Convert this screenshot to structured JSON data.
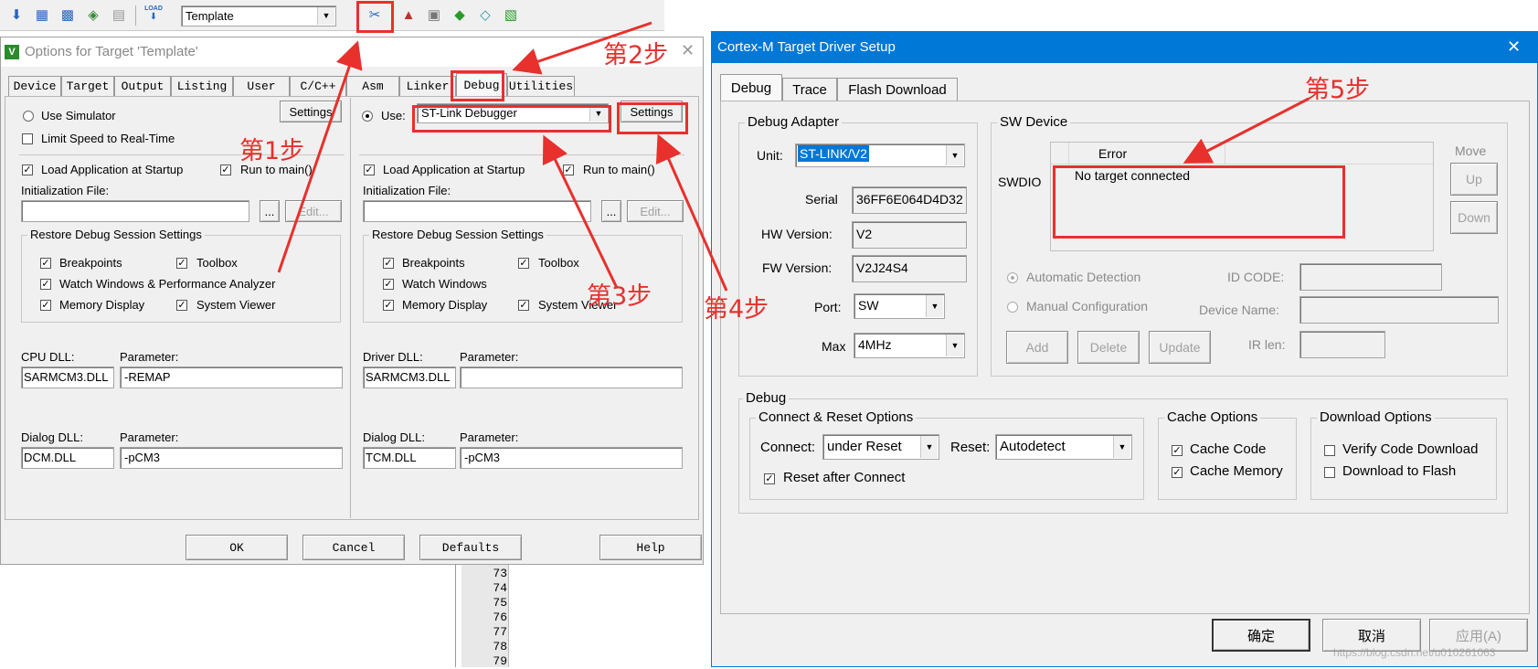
{
  "toolbar": {
    "project": "Template"
  },
  "options": {
    "title": "Options for Target 'Template'",
    "tabs": [
      "Device",
      "Target",
      "Output",
      "Listing",
      "User",
      "C/C++",
      "Asm",
      "Linker",
      "Debug",
      "Utilities"
    ],
    "left": {
      "use_simulator": "Use Simulator",
      "limit_speed": "Limit Speed to Real-Time",
      "settings": "Settings",
      "load_app": "Load Application at Startup",
      "run_to_main": "Run to main()",
      "init_file": "Initialization File:",
      "browse": "...",
      "edit": "Edit...",
      "restore_title": "Restore Debug Session Settings",
      "breakpoints": "Breakpoints",
      "toolbox": "Toolbox",
      "watch": "Watch Windows & Performance Analyzer",
      "memory": "Memory Display",
      "system_viewer": "System Viewer",
      "cpu_dll_label": "CPU DLL:",
      "cpu_param_label": "Parameter:",
      "cpu_dll": "SARMCM3.DLL",
      "cpu_param": "-REMAP",
      "dialog_dll_label": "Dialog DLL:",
      "dialog_param_label": "Parameter:",
      "dialog_dll": "DCM.DLL",
      "dialog_param": "-pCM3"
    },
    "right": {
      "use": "Use:",
      "debugger": "ST-Link Debugger",
      "settings": "Settings",
      "load_app": "Load Application at Startup",
      "run_to_main": "Run to main()",
      "init_file": "Initialization File:",
      "browse": "...",
      "edit": "Edit...",
      "restore_title": "Restore Debug Session Settings",
      "breakpoints": "Breakpoints",
      "toolbox": "Toolbox",
      "watch": "Watch Windows",
      "memory": "Memory Display",
      "system_viewer": "System Viewer",
      "driver_dll_label": "Driver DLL:",
      "driver_param_label": "Parameter:",
      "driver_dll": "SARMCM3.DLL",
      "driver_param": "",
      "dialog_dll_label": "Dialog DLL:",
      "dialog_param_label": "Parameter:",
      "dialog_dll": "TCM.DLL",
      "dialog_param": "-pCM3"
    },
    "buttons": {
      "ok": "OK",
      "cancel": "Cancel",
      "defaults": "Defaults",
      "help": "Help"
    }
  },
  "editor": {
    "lines": [
      "73",
      "74",
      "75",
      "76",
      "77",
      "78",
      "79"
    ]
  },
  "driver": {
    "title": "Cortex-M Target Driver Setup",
    "close": "✕",
    "tabs": [
      "Debug",
      "Trace",
      "Flash Download"
    ],
    "adapter": {
      "title": "Debug Adapter",
      "unit_label": "Unit:",
      "unit": "ST-LINK/V2",
      "serial_label": "Serial",
      "serial": "36FF6E064D4D32",
      "hw_label": "HW Version:",
      "hw": "V2",
      "fw_label": "FW Version:",
      "fw": "V2J24S4",
      "port_label": "Port:",
      "port": "SW",
      "max_label": "Max",
      "max": "4MHz"
    },
    "sw": {
      "title": "SW Device",
      "swdio": "SWDIO",
      "col_error": "Error",
      "message": "No target connected",
      "move": "Move",
      "up": "Up",
      "down": "Down",
      "auto": "Automatic Detection",
      "manual": "Manual Configuration",
      "id_code": "ID CODE:",
      "device_name": "Device Name:",
      "ir_len": "IR len:",
      "add": "Add",
      "delete": "Delete",
      "update": "Update"
    },
    "debug": {
      "title": "Debug",
      "cr_title": "Connect & Reset Options",
      "connect_label": "Connect:",
      "connect": "under Reset",
      "reset_label": "Reset:",
      "reset": "Autodetect",
      "reset_after": "Reset after Connect",
      "cache_title": "Cache Options",
      "cache_code": "Cache Code",
      "cache_memory": "Cache Memory",
      "dl_title": "Download Options",
      "verify": "Verify Code Download",
      "dl_flash": "Download to Flash"
    },
    "buttons": {
      "ok": "确定",
      "cancel": "取消",
      "apply": "应用(A)"
    },
    "watermark": "https://blog.csdn.net/u010261063"
  },
  "steps": [
    "第1步",
    "第2步",
    "第3步",
    "第4步",
    "第5步"
  ],
  "colors": {
    "annotation": "#e8302c",
    "titlebar": "#0078d7",
    "selection": "#0078d7"
  }
}
